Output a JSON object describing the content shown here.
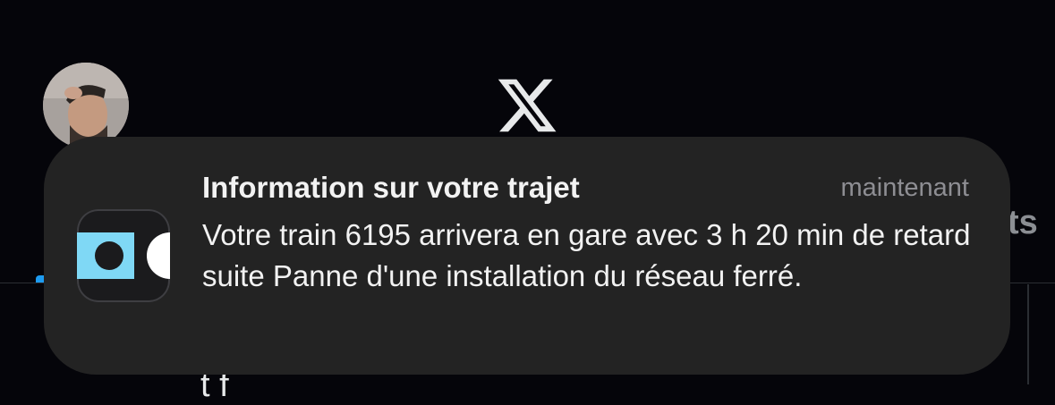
{
  "background_app": {
    "name": "X",
    "tab_partial_text": "ts",
    "tweet_text_partial": "t f"
  },
  "notification": {
    "title": "Information sur votre trajet",
    "time": "maintenant",
    "body": "Votre train 6195 arrivera en gare avec 3 h 20 min de retard suite Panne d'une installation du réseau ferré."
  },
  "colors": {
    "notification_background": "#232323",
    "app_icon_accent": "#7fd8f5",
    "x_blue": "#1d9bf0"
  }
}
